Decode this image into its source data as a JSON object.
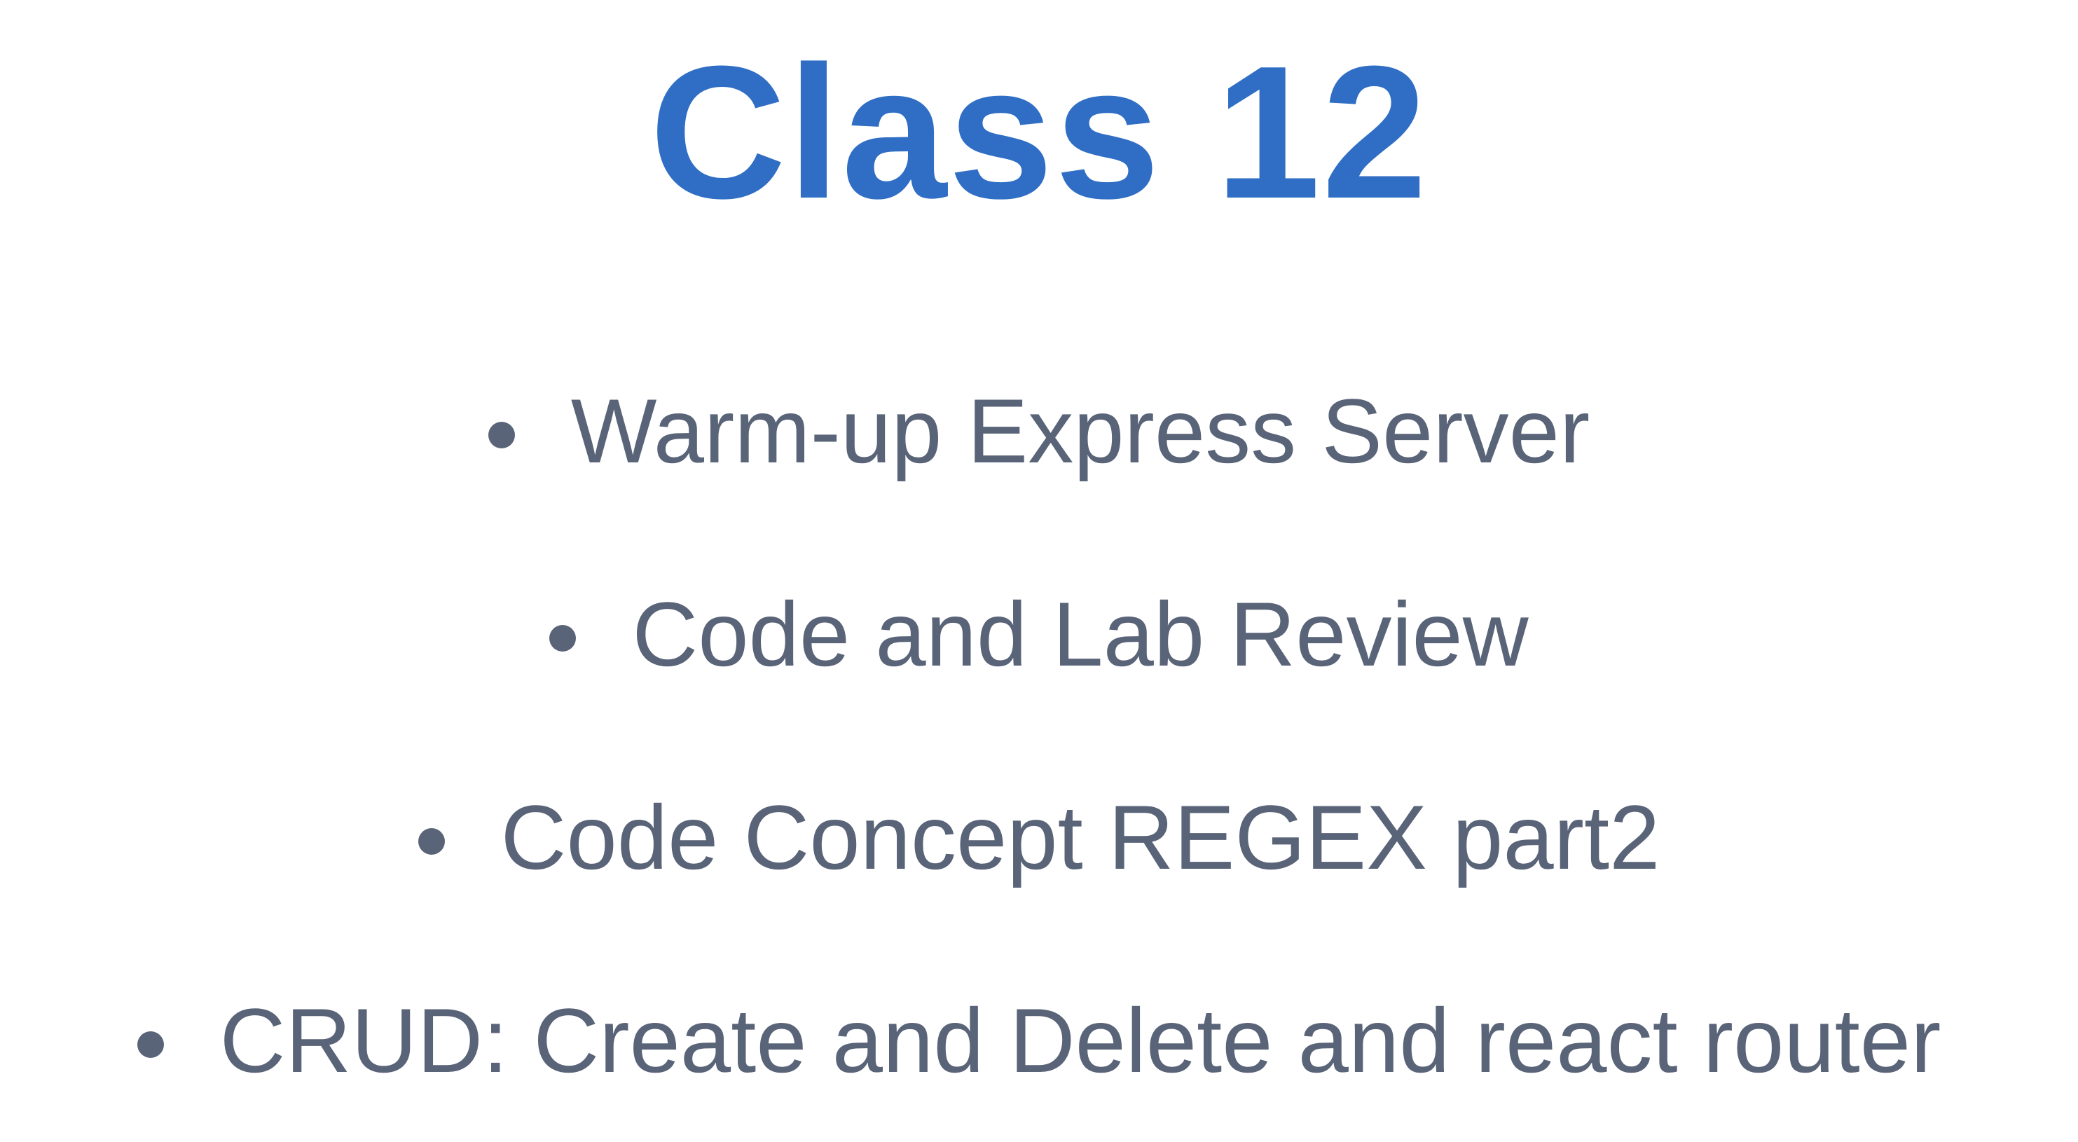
{
  "slide": {
    "title": "Class 12",
    "title_color": "#2f6ec4",
    "text_color": "#5a6478",
    "bullets": [
      "Warm-up Express Server",
      "Code and Lab Review",
      "Code Concept REGEX part2",
      "CRUD: Create and Delete and react router"
    ]
  }
}
